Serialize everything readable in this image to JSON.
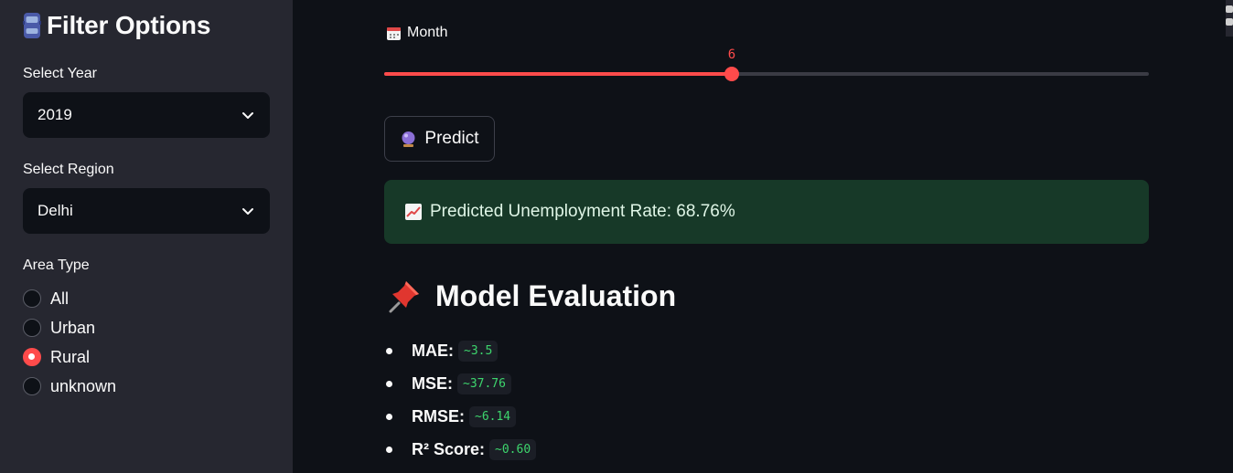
{
  "sidebar": {
    "title": "Filter Options",
    "year": {
      "label": "Select Year",
      "value": "2019"
    },
    "region": {
      "label": "Select Region",
      "value": "Delhi"
    },
    "area": {
      "label": "Area Type",
      "options": [
        "All",
        "Urban",
        "Rural",
        "unknown"
      ],
      "selected": "Rural"
    }
  },
  "main": {
    "month_slider": {
      "label": "Month",
      "value": "6",
      "min": 1,
      "max": 12
    },
    "predict_button": "Predict",
    "prediction": "Predicted Unemployment Rate: 68.76%",
    "evaluation": {
      "title": "Model Evaluation",
      "metrics": [
        {
          "label": "MAE:",
          "value": "~3.5"
        },
        {
          "label": "MSE:",
          "value": "~37.76"
        },
        {
          "label": "RMSE:",
          "value": "~6.14"
        },
        {
          "label": "R² Score:",
          "value": "~0.60"
        }
      ]
    }
  },
  "colors": {
    "accent": "#ff4b4b",
    "sidebar_bg": "#262730",
    "main_bg": "#0e1117",
    "success_bg": "#173928",
    "code_green": "#3dd56d"
  }
}
